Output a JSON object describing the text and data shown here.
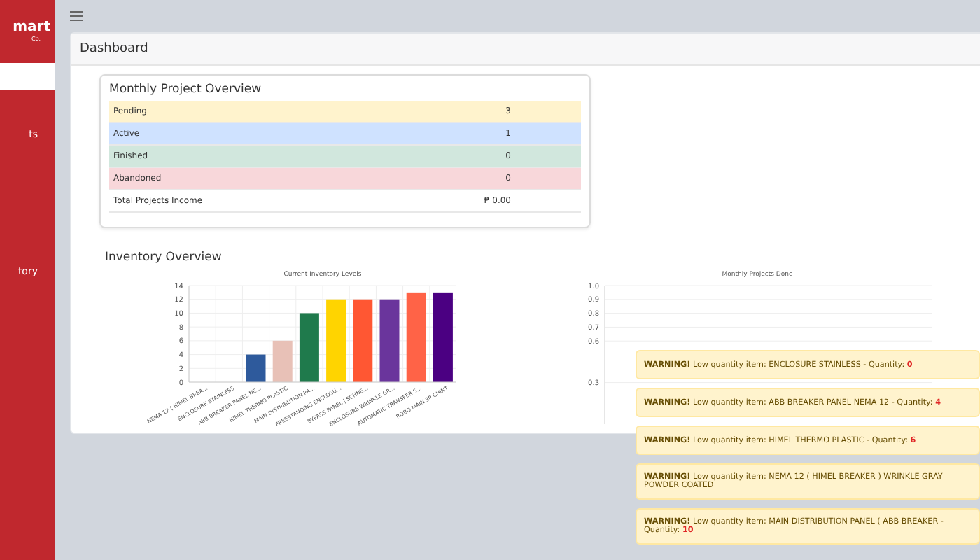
{
  "sidebar": {
    "brand": "mart",
    "brand_sub": "Co.",
    "items": [
      {
        "selected": true
      },
      {
        "label": "ts",
        "selected": false
      },
      {
        "label": "tory",
        "selected": false
      }
    ]
  },
  "page": {
    "title": "Dashboard"
  },
  "overview": {
    "title": "Monthly Project Overview",
    "rows": [
      {
        "label": "Pending",
        "value": "3",
        "color": "#fff3cd"
      },
      {
        "label": "Active",
        "value": "1",
        "color": "#cfe2ff"
      },
      {
        "label": "Finished",
        "value": "0",
        "color": "#d1e7dd"
      },
      {
        "label": "Abandoned",
        "value": "0",
        "color": "#f8d7da"
      },
      {
        "label": "Total Projects Income",
        "value": "₱ 0.00"
      }
    ]
  },
  "inventory": {
    "title": "Inventory Overview",
    "chart_data": {
      "type": "bar",
      "title": "Current Inventory Levels",
      "categories": [
        "NEMA 12 ( HIMEL BREA...",
        "ENCLOSURE STAINLESS",
        "ABB BREAKER PANEL NE...",
        "HIMEL THERMO PLASTIC",
        "MAIN DISTRIBUTION PA...",
        "FREESTANDING ENCLOSU...",
        "BYPASS PANEL | SCHNE...",
        "ENCLOSURE WRINKLE GR...",
        "AUTOMATIC TRANSFER S...",
        "ROBO MAIN 3P CHINT"
      ],
      "ylim": [
        0,
        14
      ],
      "grid": true,
      "yticks": [
        0,
        2,
        4,
        6,
        8,
        10,
        12,
        14
      ],
      "series": [
        {
          "values": [
            0,
            0,
            4,
            6,
            10,
            12,
            12,
            12,
            13,
            13
          ],
          "colors": [
            "#2e5a9c",
            "#2e5a9c",
            "#2e5a9c",
            "#e8c1b7",
            "#1f7a4c",
            "#ffd400",
            "#ff5733",
            "#6a359c",
            "#ff6347",
            "#4b0082"
          ]
        }
      ]
    }
  },
  "projects": {
    "title": "Monthly Projects Done",
    "axis_labels": [
      "1.0",
      "0.9",
      "0.8",
      "0.7",
      "0.6",
      "0.3"
    ]
  },
  "warnings": [
    {
      "label": "WARNING!",
      "message": "Low quantity item: ENCLOSURE STAINLESS - Quantity:",
      "quantity": "0"
    },
    {
      "label": "WARNING!",
      "message": "Low quantity item: ABB BREAKER PANEL NEMA 12 - Quantity:",
      "quantity": "4"
    },
    {
      "label": "WARNING!",
      "message": "Low quantity item: HIMEL THERMO PLASTIC - Quantity:",
      "quantity": "6"
    },
    {
      "label": "WARNING!",
      "message": "Low quantity item: NEMA 12 ( HIMEL BREAKER ) WRINKLE GRAY POWDER COATED"
    },
    {
      "label": "WARNING!",
      "message": "Low quantity item: MAIN DISTRIBUTION PANEL ( ABB BREAKER - Quantity:",
      "quantity": "10"
    }
  ]
}
